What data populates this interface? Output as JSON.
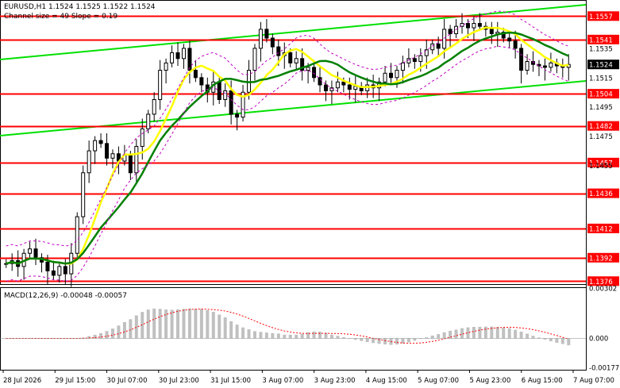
{
  "header": {
    "symbol_line": "EURUSD,H1  1.1524 1.1525 1.1522 1.1524",
    "channel_line": "Channel size = 49 Slope = 0.19",
    "macd_label": "MACD(12,26,9) -0.00048 -0.00057"
  },
  "colors": {
    "level_line": "#ff0000",
    "level_tag_bg": "#ff0000",
    "channel": "#00e000",
    "ma_fast": "#ffff00",
    "ma_slow": "#008000",
    "bollinger": "#c000c0",
    "candle": "#000000",
    "price_tag_bg": "#000000",
    "macd_hist": "#c0c0c0",
    "macd_signal": "#ff0000"
  },
  "chart_data": [
    {
      "type": "candlestick",
      "title": "EURUSD,H1",
      "price_axis_ticks": [
        "1.1557",
        "1.1541",
        "1.1535",
        "1.1524",
        "1.1515",
        "1.1504",
        "1.1495",
        "1.1482",
        "1.1475",
        "1.1457",
        "1.1455",
        "1.1436",
        "1.1412",
        "1.1392",
        "1.1376"
      ],
      "levels": [
        1.1557,
        1.1541,
        1.1504,
        1.1482,
        1.1457,
        1.1436,
        1.1412,
        1.1392,
        1.1376
      ],
      "current_price": 1.1524,
      "time_labels": [
        "28 Jul 2026",
        "29 Jul 15:00",
        "30 Jul 07:00",
        "30 Jul 23:00",
        "31 Jul 15:00",
        "3 Aug 07:00",
        "3 Aug 23:00",
        "4 Aug 15:00",
        "5 Aug 07:00",
        "5 Aug 23:00",
        "6 Aug 15:00",
        "7 Aug 07:00"
      ],
      "ylim": [
        1.1374,
        1.1568
      ],
      "closes": [
        1.1388,
        1.139,
        1.1386,
        1.1395,
        1.1398,
        1.1392,
        1.1389,
        1.1383,
        1.138,
        1.1386,
        1.1381,
        1.1395,
        1.142,
        1.145,
        1.1465,
        1.1472,
        1.147,
        1.146,
        1.1463,
        1.1458,
        1.1462,
        1.145,
        1.1468,
        1.148,
        1.149,
        1.15,
        1.152,
        1.1525,
        1.1532,
        1.1528,
        1.1535,
        1.152,
        1.1515,
        1.151,
        1.1505,
        1.1512,
        1.15,
        1.1506,
        1.149,
        1.1488,
        1.1505,
        1.152,
        1.1535,
        1.1548,
        1.1542,
        1.1536,
        1.153,
        1.1532,
        1.1525,
        1.1528,
        1.152,
        1.1522,
        1.1515,
        1.151,
        1.1506,
        1.1508,
        1.1512,
        1.151,
        1.1507,
        1.1509,
        1.1506,
        1.151,
        1.1508,
        1.1512,
        1.1518,
        1.1515,
        1.152,
        1.1525,
        1.1528,
        1.1526,
        1.153,
        1.1534,
        1.1538,
        1.1535,
        1.1548,
        1.1545,
        1.155,
        1.1552,
        1.1549,
        1.1552,
        1.155,
        1.1548,
        1.1545,
        1.1546,
        1.1542,
        1.154,
        1.1535,
        1.152,
        1.1526,
        1.1524,
        1.1523,
        1.1522,
        1.1525,
        1.1523,
        1.1522,
        1.1524
      ]
    },
    {
      "type": "bar",
      "title": "MACD(12,26,9)",
      "macd": -0.00048,
      "signal": -0.00057,
      "y_ticks": [
        "0.00302",
        "0.000",
        "-0.00177"
      ],
      "ylim": [
        -0.0019,
        0.0031
      ]
    }
  ]
}
